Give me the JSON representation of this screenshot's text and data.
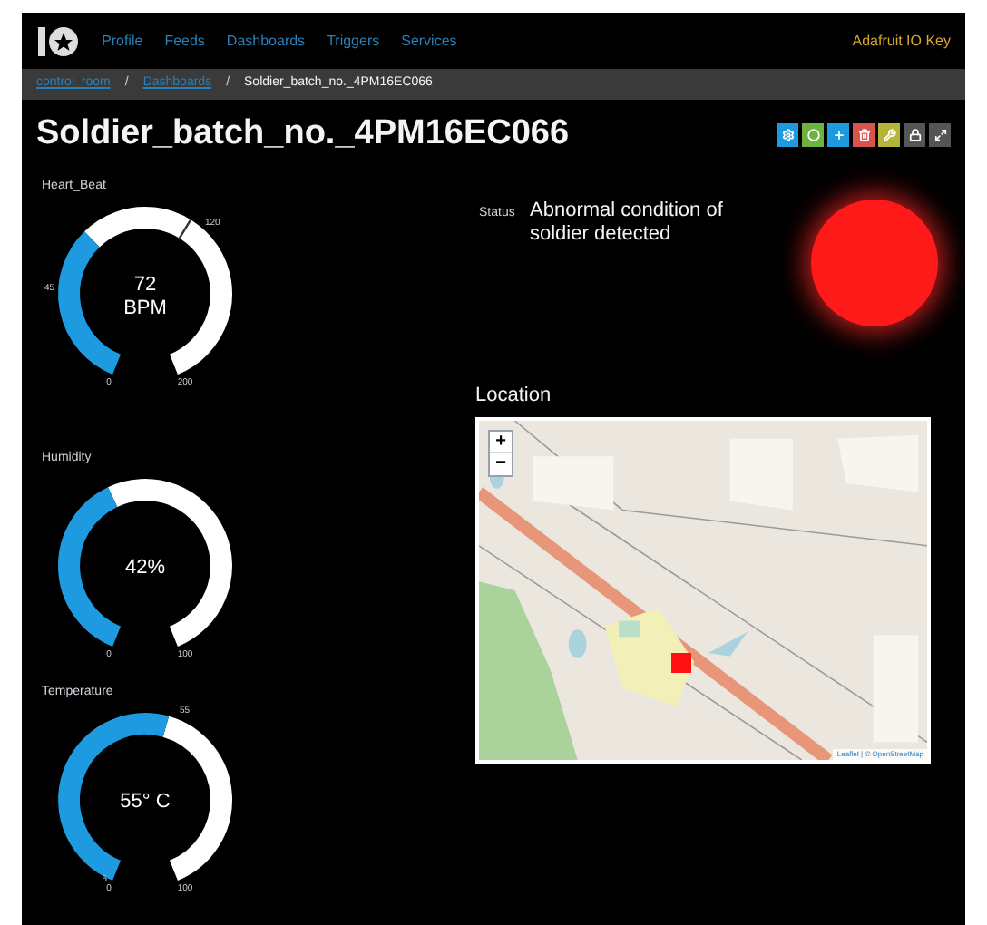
{
  "nav": {
    "items": [
      {
        "label": "Profile"
      },
      {
        "label": "Feeds"
      },
      {
        "label": "Dashboards"
      },
      {
        "label": "Triggers"
      },
      {
        "label": "Services"
      }
    ],
    "key_link": "Adafruit IO Key"
  },
  "breadcrumb": [
    {
      "label": "control_room",
      "kind": "link"
    },
    {
      "separator": "/",
      "label": "Dashboards",
      "kind": "link"
    },
    {
      "separator": "/",
      "label": "Soldier_batch_no._4PM16EC066",
      "kind": "current"
    }
  ],
  "title": "Soldier_batch_no._4PM16EC066",
  "toolbar": [
    {
      "kind": "gear",
      "color": "#1e9be0"
    },
    {
      "kind": "circle",
      "color": "#6cb33f"
    },
    {
      "kind": "plus",
      "color": "#1e9be0"
    },
    {
      "kind": "trash",
      "color": "#d9534f"
    },
    {
      "kind": "wrench",
      "color": "#b5b53a"
    },
    {
      "kind": "lock",
      "color": "#555555"
    },
    {
      "kind": "expand",
      "color": "#555555"
    }
  ],
  "gauges": [
    {
      "label": "Heart_Beat",
      "reading": [
        "72",
        "BPM"
      ],
      "min_label": "0",
      "max_label": "200",
      "marks": [
        {
          "label": "45",
          "tick": false
        },
        {
          "label": "120",
          "tick": true
        }
      ]
    },
    {
      "label": "Humidity",
      "reading": [
        "42%"
      ],
      "min_label": "0",
      "max_label": "100"
    },
    {
      "label": "Temperature",
      "reading": [
        "55° C"
      ],
      "min_label": "0",
      "max_label": "100",
      "marks": [
        {
          "label": "5",
          "tick": false
        },
        {
          "label": "55",
          "tick": false
        }
      ]
    }
  ],
  "status": {
    "label": "Status",
    "text": "Abnormal condition of soldier detected",
    "on": true
  },
  "location": {
    "title": "Location",
    "zoom_in": "+",
    "zoom_out": "−",
    "attribution": "Leaflet | © OpenStreetMap"
  }
}
